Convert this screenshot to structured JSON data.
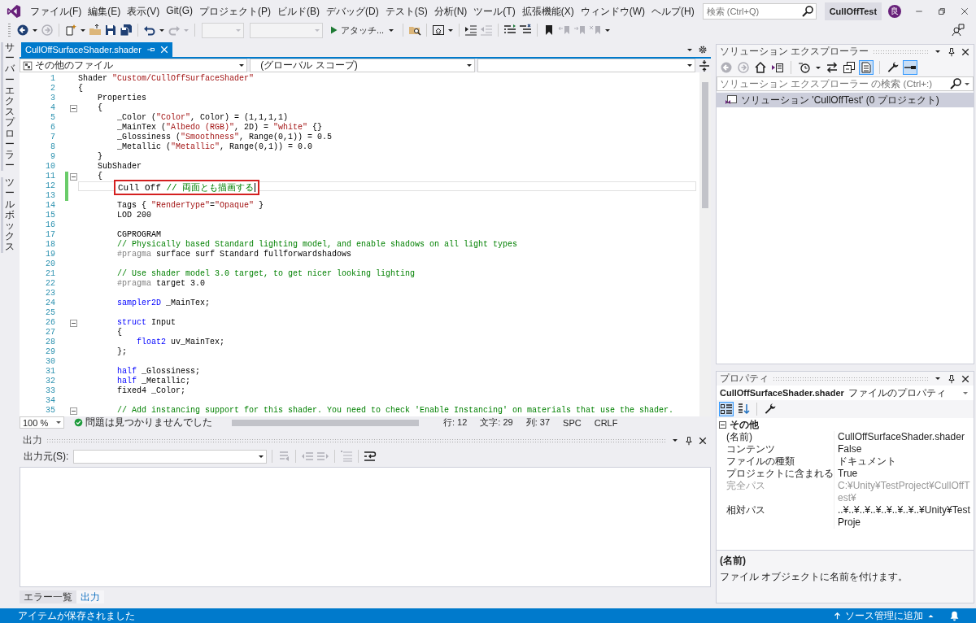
{
  "menu": [
    "ファイル(F)",
    "編集(E)",
    "表示(V)",
    "Git(G)",
    "プロジェクト(P)",
    "ビルド(B)",
    "デバッグ(D)",
    "テスト(S)",
    "分析(N)",
    "ツール(T)",
    "拡張機能(X)",
    "ウィンドウ(W)",
    "ヘルプ(H)"
  ],
  "search": {
    "placeholder": "検索 (Ctrl+Q)"
  },
  "solution_name": "CullOffTest",
  "account": {
    "initial": "良"
  },
  "toolbar": [
    {
      "kind": "back",
      "disabled": false
    },
    {
      "kind": "caret",
      "disabled": false
    },
    {
      "kind": "forward",
      "disabled": true
    },
    {
      "kind": "separator"
    },
    {
      "kind": "new-item",
      "disabled": false
    },
    {
      "kind": "caret",
      "disabled": false
    },
    {
      "kind": "open",
      "disabled": false
    },
    {
      "kind": "save",
      "disabled": false
    },
    {
      "kind": "save-all",
      "disabled": false
    },
    {
      "kind": "separator"
    },
    {
      "kind": "undo",
      "disabled": false
    },
    {
      "kind": "caret",
      "disabled": false
    },
    {
      "kind": "redo",
      "disabled": true
    },
    {
      "kind": "caret",
      "disabled": true
    },
    {
      "kind": "separator"
    },
    {
      "kind": "dropdown",
      "disabled": true
    },
    {
      "kind": "dropdown",
      "disabled": true
    },
    {
      "kind": "run",
      "label": "アタッチ...",
      "disabled": false
    },
    {
      "kind": "separator"
    },
    {
      "kind": "find-files",
      "disabled": false
    },
    {
      "kind": "separator"
    },
    {
      "kind": "browser",
      "disabled": false
    },
    {
      "kind": "caret",
      "disabled": false
    },
    {
      "kind": "separator"
    },
    {
      "kind": "indent",
      "disabled": false
    },
    {
      "kind": "outdent",
      "disabled": true
    },
    {
      "kind": "separator"
    },
    {
      "kind": "comment",
      "disabled": false
    },
    {
      "kind": "uncomment",
      "disabled": false
    },
    {
      "kind": "separator"
    },
    {
      "kind": "bookmark",
      "disabled": false
    },
    {
      "kind": "bookmark-prev",
      "disabled": true
    },
    {
      "kind": "bookmark-next",
      "disabled": true
    },
    {
      "kind": "bookmark-clear",
      "disabled": true
    },
    {
      "kind": "caret",
      "disabled": false
    }
  ],
  "side_tabs": [
    {
      "label": "サーバーエクスプローラー"
    },
    {
      "label": "ツールボックス"
    }
  ],
  "editor": {
    "tab": {
      "title": "CullOffSurfaceShader.shader",
      "selected": true
    },
    "nav": [
      "その他のファイル",
      "(グローバル スコープ)"
    ],
    "lines": [
      {
        "number": "1",
        "tokens": [
          {
            "kind": "plain",
            "text": "Shader "
          },
          {
            "kind": "string",
            "text": "\"Custom/CullOffSurfaceShader\""
          }
        ]
      },
      {
        "number": "2",
        "tokens": [
          {
            "kind": "plain",
            "text": "{"
          }
        ]
      },
      {
        "number": "3",
        "tokens": [
          {
            "kind": "plain",
            "text": "    Properties"
          }
        ]
      },
      {
        "number": "4",
        "fold": true,
        "tokens": [
          {
            "kind": "plain",
            "text": "    {"
          }
        ]
      },
      {
        "number": "5",
        "tokens": [
          {
            "kind": "plain",
            "text": "        _Color ("
          },
          {
            "kind": "string",
            "text": "\"Color\""
          },
          {
            "kind": "plain",
            "text": ", Color) = (1,1,1,1)"
          }
        ]
      },
      {
        "number": "6",
        "tokens": [
          {
            "kind": "plain",
            "text": "        _MainTex ("
          },
          {
            "kind": "string",
            "text": "\"Albedo (RGB)\""
          },
          {
            "kind": "plain",
            "text": ", 2D) = "
          },
          {
            "kind": "string",
            "text": "\"white\""
          },
          {
            "kind": "plain",
            "text": " {}"
          }
        ]
      },
      {
        "number": "7",
        "tokens": [
          {
            "kind": "plain",
            "text": "        _Glossiness ("
          },
          {
            "kind": "string",
            "text": "\"Smoothness\""
          },
          {
            "kind": "plain",
            "text": ", Range(0,1)) = 0.5"
          }
        ]
      },
      {
        "number": "8",
        "tokens": [
          {
            "kind": "plain",
            "text": "        _Metallic ("
          },
          {
            "kind": "string",
            "text": "\"Metallic\""
          },
          {
            "kind": "plain",
            "text": ", Range(0,1)) = 0.0"
          }
        ]
      },
      {
        "number": "9",
        "tokens": [
          {
            "kind": "plain",
            "text": "    }"
          }
        ]
      },
      {
        "number": "10",
        "tokens": [
          {
            "kind": "plain",
            "text": "    SubShader"
          }
        ]
      },
      {
        "number": "11",
        "fold": true,
        "changed": true,
        "tokens": [
          {
            "kind": "plain",
            "text": "    {"
          }
        ]
      },
      {
        "number": "12",
        "changed": true,
        "current": true,
        "highlighted": true,
        "tokens": [
          {
            "kind": "plain",
            "text": "Cull Off "
          },
          {
            "kind": "comment",
            "text": "// 両面とも描画する"
          }
        ]
      },
      {
        "number": "13",
        "changed": true
      },
      {
        "number": "14",
        "tokens": [
          {
            "kind": "plain",
            "text": "        Tags { "
          },
          {
            "kind": "string",
            "text": "\"RenderType\""
          },
          {
            "kind": "plain",
            "text": "="
          },
          {
            "kind": "string",
            "text": "\"Opaque\""
          },
          {
            "kind": "plain",
            "text": " }"
          }
        ]
      },
      {
        "number": "15",
        "tokens": [
          {
            "kind": "plain",
            "text": "        LOD 200"
          }
        ]
      },
      {
        "number": "16"
      },
      {
        "number": "17",
        "tokens": [
          {
            "kind": "plain",
            "text": "        CGPROGRAM"
          }
        ]
      },
      {
        "number": "18",
        "tokens": [
          {
            "kind": "comment",
            "text": "        // Physically based Standard lighting model, and enable shadows on all light types"
          }
        ]
      },
      {
        "number": "19",
        "tokens": [
          {
            "kind": "pragma",
            "text": "        #pragma"
          },
          {
            "kind": "plain",
            "text": " surface surf Standard fullforwardshadows"
          }
        ]
      },
      {
        "number": "20"
      },
      {
        "number": "21",
        "tokens": [
          {
            "kind": "comment",
            "text": "        // Use shader model 3.0 target, to get nicer looking lighting"
          }
        ]
      },
      {
        "number": "22",
        "tokens": [
          {
            "kind": "pragma",
            "text": "        #pragma"
          },
          {
            "kind": "plain",
            "text": " target 3.0"
          }
        ]
      },
      {
        "number": "23"
      },
      {
        "number": "24",
        "tokens": [
          {
            "kind": "keyword",
            "text": "        sampler2D"
          },
          {
            "kind": "plain",
            "text": " _MainTex;"
          }
        ]
      },
      {
        "number": "25"
      },
      {
        "number": "26",
        "fold": true,
        "tokens": [
          {
            "kind": "keyword",
            "text": "        struct"
          },
          {
            "kind": "plain",
            "text": " Input"
          }
        ]
      },
      {
        "number": "27",
        "tokens": [
          {
            "kind": "plain",
            "text": "        {"
          }
        ]
      },
      {
        "number": "28",
        "tokens": [
          {
            "kind": "keyword",
            "text": "            float2"
          },
          {
            "kind": "plain",
            "text": " uv_MainTex;"
          }
        ]
      },
      {
        "number": "29",
        "tokens": [
          {
            "kind": "plain",
            "text": "        };"
          }
        ]
      },
      {
        "number": "30"
      },
      {
        "number": "31",
        "tokens": [
          {
            "kind": "keyword",
            "text": "        half"
          },
          {
            "kind": "plain",
            "text": " _Glossiness;"
          }
        ]
      },
      {
        "number": "32",
        "tokens": [
          {
            "kind": "keyword",
            "text": "        half"
          },
          {
            "kind": "plain",
            "text": " _Metallic;"
          }
        ]
      },
      {
        "number": "33",
        "tokens": [
          {
            "kind": "plain",
            "text": "        fixed4 _Color;"
          }
        ]
      },
      {
        "number": "34"
      },
      {
        "number": "35",
        "fold": true,
        "tokens": [
          {
            "kind": "comment",
            "text": "        // Add instancing support for this shader. You need to check 'Enable Instancing' on materials that use the shader."
          }
        ]
      }
    ],
    "status": {
      "zoom": "100 %",
      "issues": "問題は見つかりませんでした",
      "line": "行: 12",
      "char": "文字: 29",
      "col": "列: 37",
      "whitespace": "SPC",
      "eol": "CRLF"
    }
  },
  "output": {
    "title": "出力",
    "source_label": "出力元(S):",
    "toolbar": [
      {
        "kind": "find-message",
        "disabled": true
      },
      {
        "kind": "separator"
      },
      {
        "kind": "prev-message",
        "disabled": true
      },
      {
        "kind": "next-message",
        "disabled": true
      },
      {
        "kind": "separator"
      },
      {
        "kind": "clear-all",
        "disabled": true
      },
      {
        "kind": "separator"
      },
      {
        "kind": "word-wrap",
        "disabled": false
      }
    ],
    "tabs": [
      {
        "label": "エラー一覧",
        "selected": false
      },
      {
        "label": "出力",
        "selected": true
      }
    ]
  },
  "solution_explorer": {
    "title": "ソリューション エクスプローラー",
    "toolbar": [
      {
        "kind": "back",
        "disabled": true,
        "selected": false
      },
      {
        "kind": "forward",
        "disabled": true,
        "selected": false
      },
      {
        "kind": "home",
        "disabled": false,
        "selected": false
      },
      {
        "kind": "switch-views",
        "disabled": false,
        "selected": false
      },
      {
        "kind": "separator"
      },
      {
        "kind": "history",
        "disabled": false,
        "selected": false
      },
      {
        "kind": "caret",
        "disabled": false,
        "selected": false
      },
      {
        "kind": "sync",
        "disabled": false,
        "selected": false
      },
      {
        "kind": "collapse",
        "disabled": false,
        "selected": false
      },
      {
        "kind": "show-all",
        "disabled": false,
        "selected": true
      },
      {
        "kind": "separator"
      },
      {
        "kind": "wrench",
        "disabled": false,
        "selected": false
      },
      {
        "kind": "preview",
        "disabled": false,
        "selected": true
      }
    ],
    "search_placeholder": "ソリューション エクスプローラー の検索 (Ctrl+:)",
    "items": [
      {
        "label": "ソリューション 'CullOffTest' (0 プロジェクト)",
        "selected": true
      }
    ]
  },
  "properties": {
    "title": "プロパティ",
    "object": "CullOffSurfaceShader.shader",
    "object_type": "ファイルのプロパティ",
    "toolbar": [
      {
        "kind": "categorized",
        "selected": true
      },
      {
        "kind": "alphabetical",
        "selected": false
      },
      {
        "kind": "separator"
      },
      {
        "kind": "wrench",
        "selected": false
      }
    ],
    "category": "その他",
    "rows": [
      {
        "name": "(名前)",
        "value": "CullOffSurfaceShader.shader",
        "disabled": false
      },
      {
        "name": "コンテンツ",
        "value": "False",
        "disabled": false
      },
      {
        "name": "ファイルの種類",
        "value": "ドキュメント",
        "disabled": false
      },
      {
        "name": "プロジェクトに含まれる",
        "value": "True",
        "disabled": false
      },
      {
        "name": "完全パス",
        "value": "C:¥Unity¥TestProject¥CullOffTest¥",
        "disabled": true
      },
      {
        "name": "相対パス",
        "value": "..¥..¥..¥..¥..¥..¥..¥..¥Unity¥TestProje",
        "disabled": false
      }
    ],
    "description_title": "(名前)",
    "description": "ファイル オブジェクトに名前を付けます。"
  },
  "status_bar": {
    "message": "アイテムが保存されました",
    "source_control": "ソース管理に追加"
  }
}
